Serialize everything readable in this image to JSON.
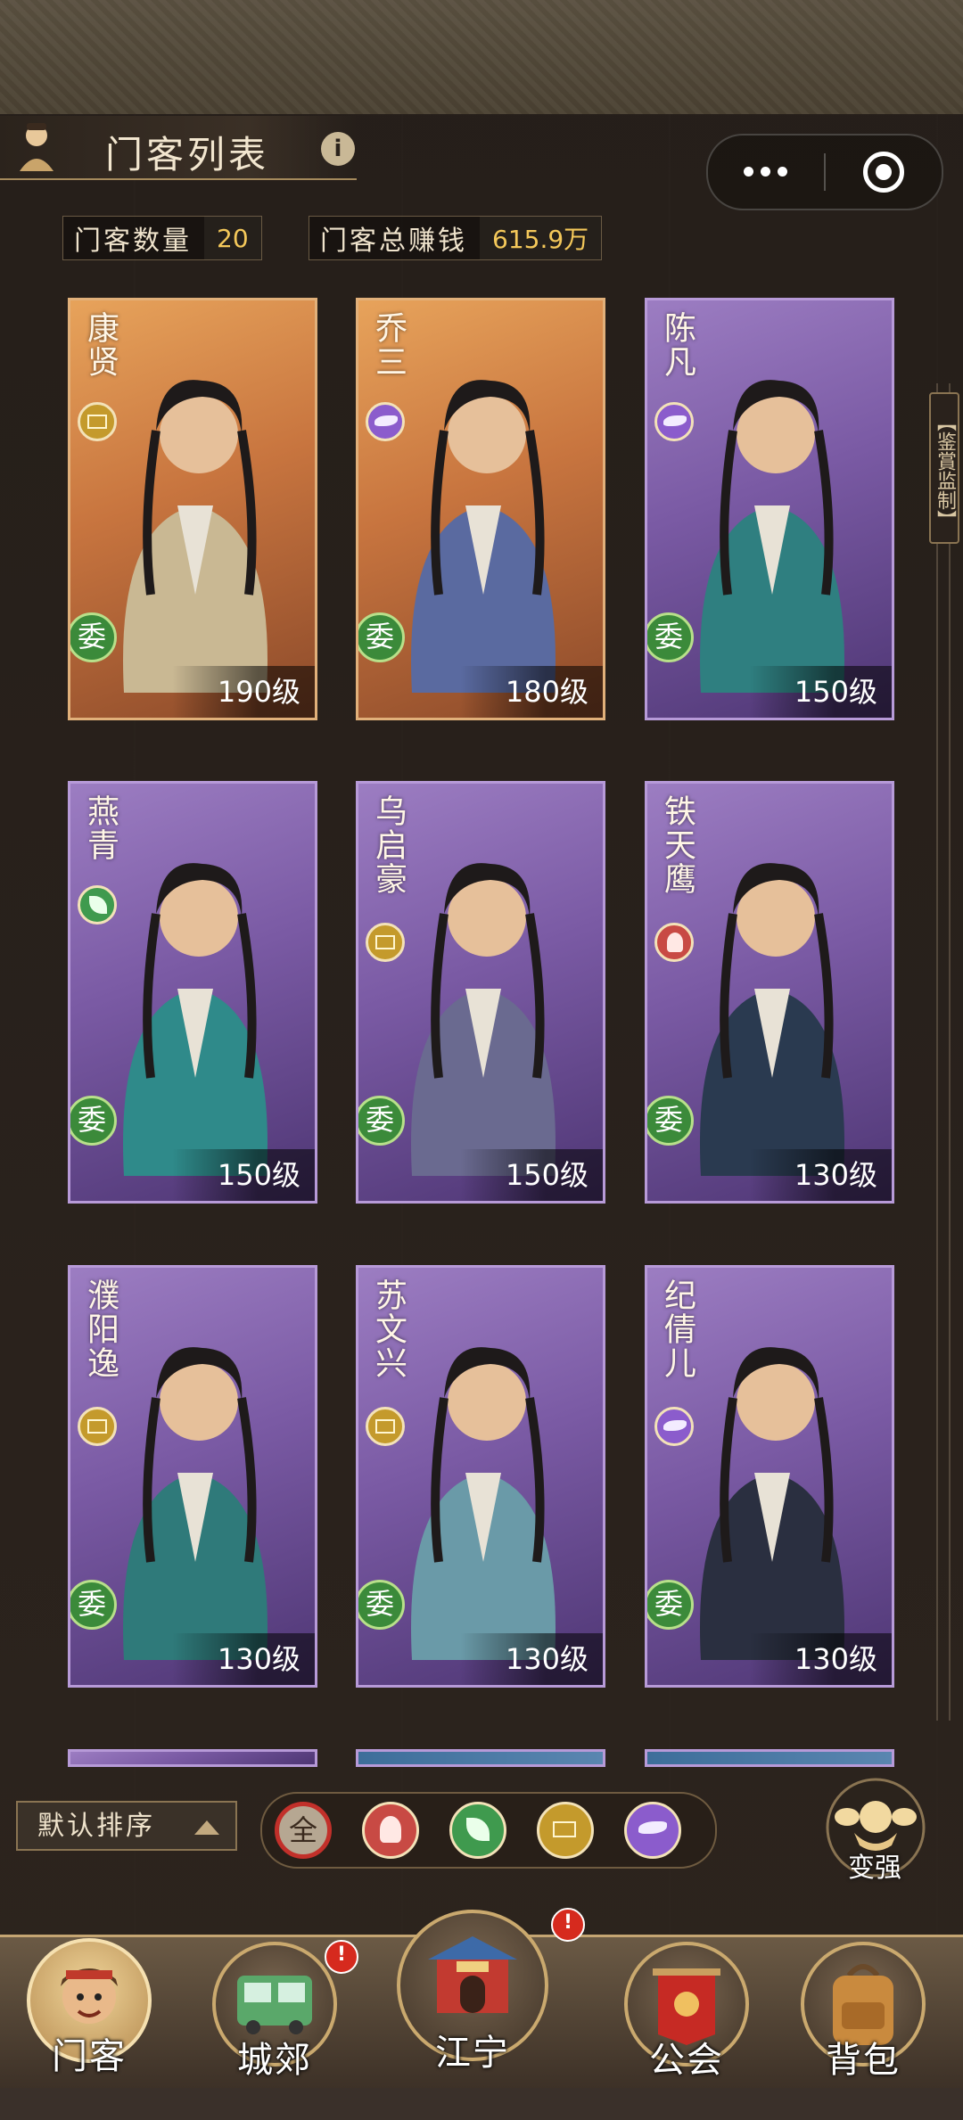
{
  "header": {
    "title": "门客列表",
    "info": "i"
  },
  "stats": {
    "count_label": "门客数量",
    "count_value": "20",
    "earn_label": "门客总赚钱",
    "earn_value": "615.9万"
  },
  "side_tab": "【鉴賞监制】",
  "cards": [
    {
      "name": "康贤",
      "type": "mahjong-icon",
      "assign": "委",
      "level": "190级",
      "rarity": "orange"
    },
    {
      "name": "乔三",
      "type": "horse-icon",
      "assign": "委",
      "level": "180级",
      "rarity": "orange"
    },
    {
      "name": "陈凡",
      "type": "horse-icon",
      "assign": "委",
      "level": "150级",
      "rarity": "purple"
    },
    {
      "name": "燕青",
      "type": "leaf-icon",
      "assign": "委",
      "level": "150级",
      "rarity": "purple"
    },
    {
      "name": "乌启豪",
      "type": "mahjong-icon",
      "assign": "委",
      "level": "150级",
      "rarity": "purple"
    },
    {
      "name": "铁天鹰",
      "type": "person-icon",
      "assign": "委",
      "level": "130级",
      "rarity": "purple"
    },
    {
      "name": "濮阳逸",
      "type": "mahjong-icon",
      "assign": "委",
      "level": "130级",
      "rarity": "purple"
    },
    {
      "name": "苏文兴",
      "type": "mahjong-icon",
      "assign": "委",
      "level": "130级",
      "rarity": "purple"
    },
    {
      "name": "纪倩儿",
      "type": "horse-icon",
      "assign": "委",
      "level": "130级",
      "rarity": "purple"
    }
  ],
  "sort": {
    "label": "默认排序"
  },
  "filters": [
    {
      "label": "全",
      "icon": "all-icon",
      "selected": true
    },
    {
      "icon": "person-icon"
    },
    {
      "icon": "leaf-icon"
    },
    {
      "icon": "mahjong-icon"
    },
    {
      "icon": "horse-icon"
    }
  ],
  "power": {
    "label": "变强",
    "icon": "strong-man-icon"
  },
  "nav": [
    {
      "label": "门客",
      "icon": "hero-icon",
      "active": true
    },
    {
      "label": "城郊",
      "icon": "bus-icon",
      "badge": "!"
    },
    {
      "label": "江宁",
      "icon": "city-gate-icon",
      "badge": "!"
    },
    {
      "label": "公会",
      "icon": "flag-icon"
    },
    {
      "label": "背包",
      "icon": "backpack-icon"
    }
  ],
  "colors": {
    "accent_gold": "#f4c85a",
    "badge_red": "#d62a1e",
    "orange_card": "#d9884a",
    "purple_card": "#7a5aa4"
  }
}
